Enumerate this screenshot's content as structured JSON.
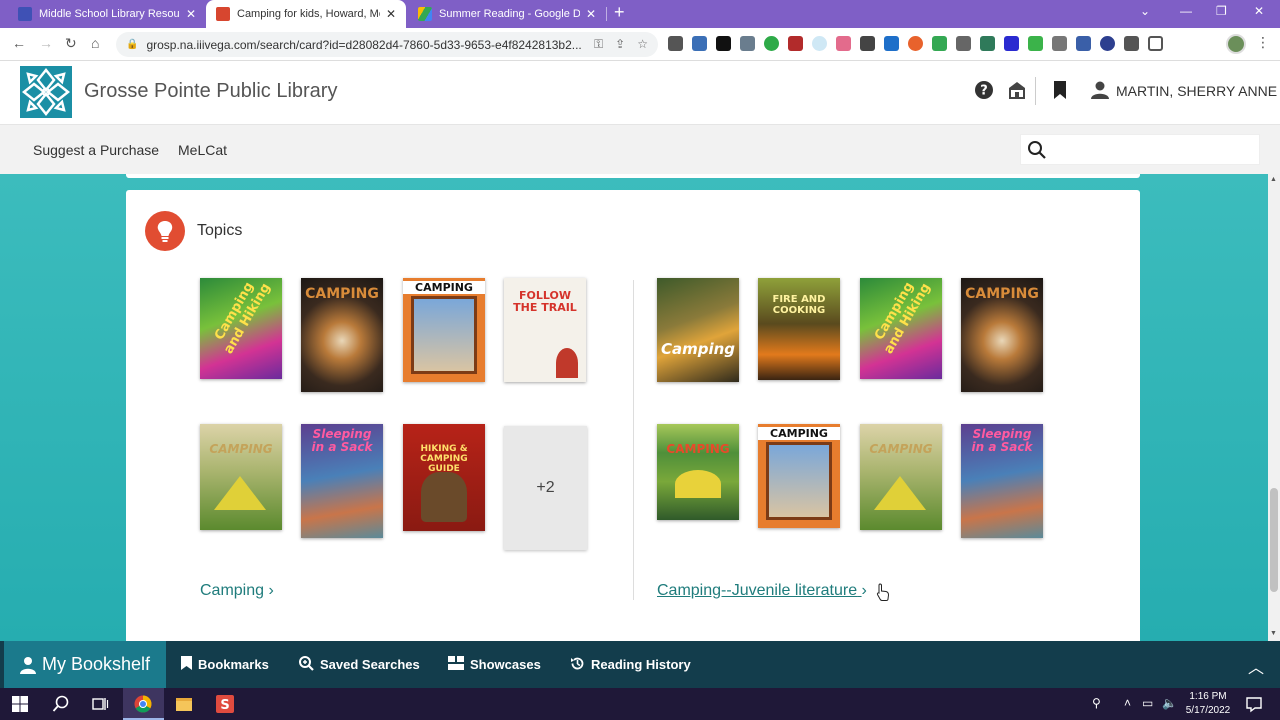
{
  "browser": {
    "tabs": [
      {
        "title": "Middle School Library Resources",
        "active": false
      },
      {
        "title": "Camping for kids, Howard, Melanie",
        "active": true
      },
      {
        "title": "Summer Reading - Google Drive",
        "active": false
      }
    ],
    "url": "grosp.na.iiivega.com/search/card?id=d28082d4-7860-5d33-9653-e4f8242813b2..."
  },
  "library": {
    "name": "Grosse Pointe Public Library",
    "user": "MARTIN, SHERRY ANNE"
  },
  "subnav": {
    "items": [
      "Suggest a Purchase",
      "MeLCat"
    ],
    "search_placeholder": ""
  },
  "topics": {
    "heading": "Topics",
    "groups": [
      {
        "link_label": "Camping",
        "more_count": "+2",
        "covers": [
          {
            "title": "Camping and Hiking",
            "theme": "green-pink"
          },
          {
            "title": "CAMPING",
            "theme": "brown-smores"
          },
          {
            "title": "CAMPING",
            "theme": "orange-family"
          },
          {
            "title": "FOLLOW THE TRAIL",
            "theme": "white-red"
          },
          {
            "title": "CAMPING",
            "theme": "tent-outdoor"
          },
          {
            "title": "Sleeping in a Sack",
            "theme": "purple-tent"
          },
          {
            "title": "HIKING & CAMPING GUIDE",
            "theme": "red-guide"
          }
        ]
      },
      {
        "link_label": "Camping--Juvenile literature",
        "covers": [
          {
            "title": "Camping",
            "theme": "photo-fire"
          },
          {
            "title": "FIRE AND COOKING",
            "theme": "campfire"
          },
          {
            "title": "Camping and Hiking",
            "theme": "green-pink"
          },
          {
            "title": "CAMPING",
            "theme": "brown-smores"
          },
          {
            "title": "CAMPING",
            "theme": "green-kids"
          },
          {
            "title": "CAMPING",
            "theme": "orange-family"
          },
          {
            "title": "CAMPING",
            "theme": "tent-outdoor"
          },
          {
            "title": "Sleeping in a Sack",
            "theme": "purple-tent"
          }
        ]
      }
    ]
  },
  "bookshelf": {
    "my_bookshelf": "My Bookshelf",
    "bookmarks": "Bookmarks",
    "saved_searches": "Saved Searches",
    "showcases": "Showcases",
    "reading_history": "Reading History"
  },
  "taskbar": {
    "time": "1:16 PM",
    "date": "5/17/2022"
  },
  "colors": {
    "tabstrip": "#7f5fc6",
    "teal_bg": "#2ab3b3",
    "topics_icon": "#e14d32",
    "link": "#1f7c7c",
    "shelf_bar": "#133d4c"
  }
}
